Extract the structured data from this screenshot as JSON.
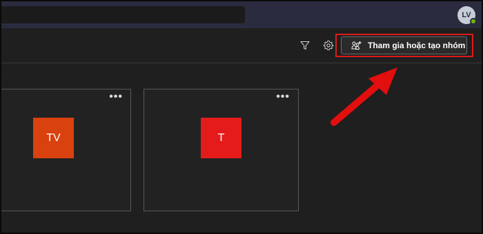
{
  "header": {
    "avatar_initials": "LV"
  },
  "toolbar": {
    "join_create_label": "Tham gia hoặc tạo nhóm"
  },
  "teams": [
    {
      "initials": "TV",
      "color": "#d9410f"
    },
    {
      "initials": "T",
      "color": "#e51b1b"
    }
  ],
  "more_label": "•••",
  "colors": {
    "title_bar": "#2b2b40",
    "background": "#1f1f1f",
    "highlight": "#e11a1a",
    "presence": "#6bb700"
  },
  "icons": [
    "filter-icon",
    "gear-icon",
    "people-add-icon",
    "more-options-icon",
    "arrow-annotation"
  ]
}
